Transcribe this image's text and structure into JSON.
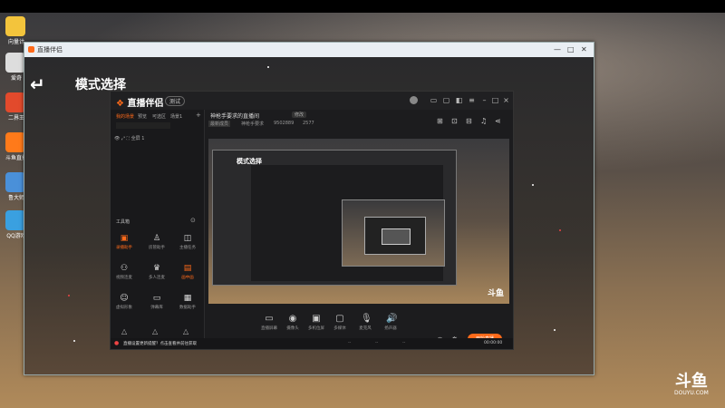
{
  "desktop": {
    "icons": [
      {
        "label": "向量计"
      },
      {
        "label": "爱奇"
      },
      {
        "label": "二界王"
      },
      {
        "label": "斗鱼直播"
      },
      {
        "label": "鲁大师"
      },
      {
        "label": "QQ游戏"
      }
    ]
  },
  "window": {
    "title": "直播伴侣",
    "controls": [
      "—",
      "□",
      "✕"
    ]
  },
  "mode_select": {
    "back_icon": "back-arrow-icon",
    "title": "模式选择"
  },
  "app": {
    "logo": "直播伴侣",
    "version_badge": "测试",
    "tabs": [
      "我的场景",
      "预览",
      "可选区",
      "场景1"
    ],
    "scene_item": "全屏 1",
    "room_title": "神枪手要求的直播间",
    "room_tag": "修改",
    "meta": [
      "最新成员",
      "神枪手要求",
      "9502889",
      "2577"
    ],
    "tools_label": "工具箱",
    "tools": [
      {
        "label": "录播助手",
        "accent": true
      },
      {
        "label": "房管助手",
        "accent": false
      },
      {
        "label": "主播任务",
        "accent": false
      },
      {
        "label": "视频连麦",
        "accent": false
      },
      {
        "label": "多人连麦",
        "accent": false
      },
      {
        "label": "画中画",
        "accent": true
      },
      {
        "label": "虚拟形象",
        "accent": false
      },
      {
        "label": "弹幕库",
        "accent": false
      },
      {
        "label": "数据助手",
        "accent": false
      }
    ],
    "bottom_tools": [
      {
        "label": "直播屏幕"
      },
      {
        "label": "摄像头"
      },
      {
        "label": "多机位屏"
      },
      {
        "label": "多媒体"
      },
      {
        "label": "麦克风"
      },
      {
        "label": "扬声器"
      }
    ],
    "start_button": "开始直播",
    "status_warning": "直播设置更新提醒？点击查看并前往获取",
    "status_right": [
      "00:00:00",
      "--",
      "--",
      "--"
    ]
  },
  "watermark": {
    "logo": "斗鱼",
    "url": "DOUYU.COM"
  },
  "colors": {
    "accent": "#ff6a1a",
    "window_title_bg": "#e9eef3",
    "app_bg": "#1b1b1d"
  }
}
